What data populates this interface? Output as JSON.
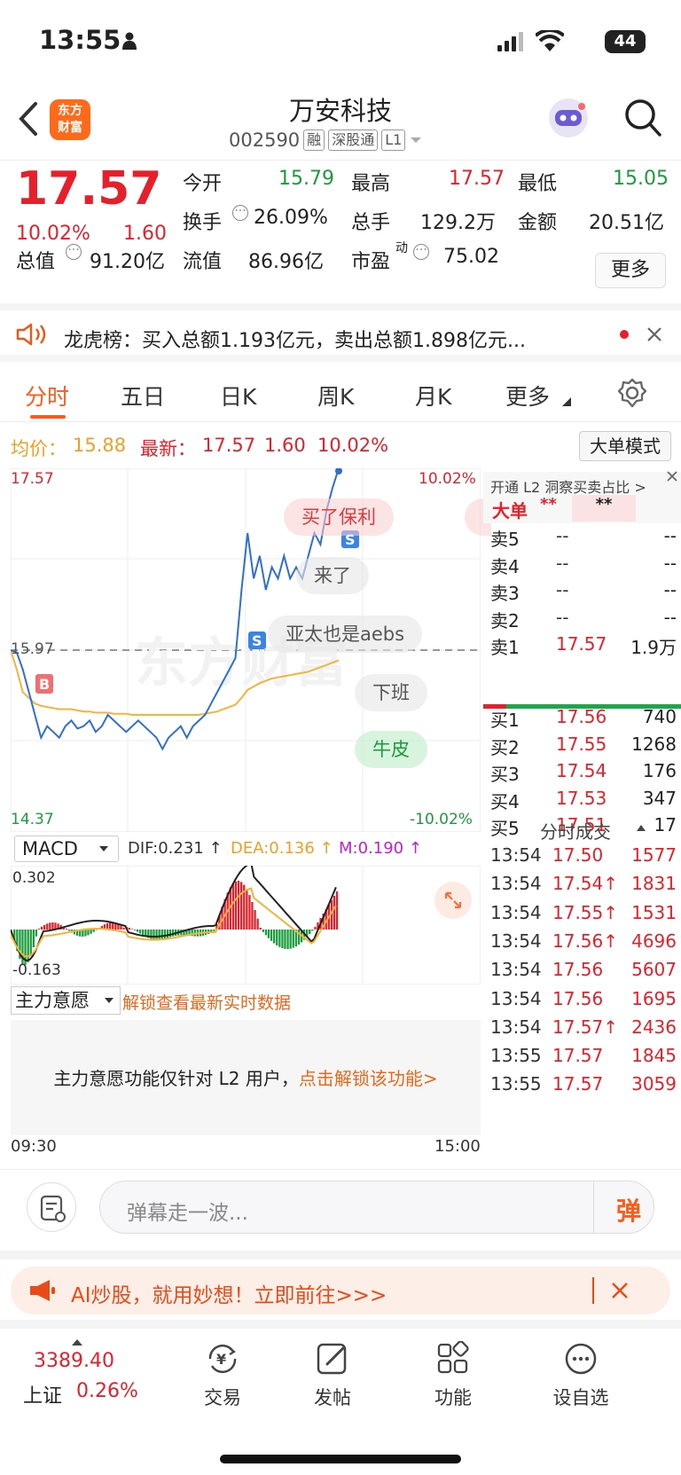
{
  "status": {
    "time": "13:55",
    "battery": "44"
  },
  "header": {
    "name": "万安科技",
    "code": "002590",
    "tags": [
      "融",
      "深股通",
      "L1"
    ],
    "logo_line1": "东方",
    "logo_line2": "财富"
  },
  "quote": {
    "price": "17.57",
    "change_pct": "10.02%",
    "change": "1.60",
    "open_label": "今开",
    "open": "15.79",
    "high_label": "最高",
    "high": "17.57",
    "low_label": "最低",
    "low": "15.05",
    "turnover_label": "换手",
    "turnover": "26.09%",
    "volume_label": "总手",
    "volume": "129.2万",
    "amount_label": "金额",
    "amount": "20.51亿",
    "mktcap_label": "总值",
    "mktcap": "91.20亿",
    "float_label": "流值",
    "float": "86.96亿",
    "pe_label": "市盈",
    "pe_sup": "动",
    "pe": "75.02",
    "more": "更多"
  },
  "notice": {
    "text": "龙虎榜：买入总额1.193亿元，卖出总额1.898亿元..."
  },
  "tabs": [
    "分时",
    "五日",
    "日K",
    "周K",
    "月K",
    "更多"
  ],
  "avg": {
    "avg_label": "均价：",
    "avg": "15.88",
    "latest_label": "最新：",
    "latest": "17.57",
    "chg": "1.60",
    "pct": "10.02%",
    "big_order_mode": "大单模式"
  },
  "chart_data": {
    "type": "line",
    "title": "",
    "y_top": "17.57",
    "y_bottom": "14.37",
    "pct_top": "10.02%",
    "pct_bottom": "-10.02%",
    "prev_close_label": "15.97",
    "ylim": [
      14.37,
      17.57
    ],
    "x_start": "09:30",
    "x_end": "15:00",
    "series": [
      {
        "name": "价格",
        "values": [
          15.97,
          15.95,
          15.8,
          15.6,
          15.4,
          15.2,
          15.3,
          15.25,
          15.2,
          15.3,
          15.35,
          15.28,
          15.3,
          15.35,
          15.25,
          15.3,
          15.4,
          15.35,
          15.3,
          15.25,
          15.3,
          15.35,
          15.3,
          15.25,
          15.2,
          15.1,
          15.2,
          15.25,
          15.3,
          15.2,
          15.3,
          15.35,
          15.4,
          15.5,
          15.6,
          15.7,
          15.8,
          15.9,
          16.5,
          17.0,
          16.6,
          16.8,
          16.5,
          16.7,
          16.6,
          16.8,
          16.6,
          16.7,
          16.6,
          16.8,
          17.0,
          16.9,
          17.2,
          17.4,
          17.57
        ]
      },
      {
        "name": "均价",
        "values": [
          15.97,
          15.8,
          15.6,
          15.55,
          15.5,
          15.48,
          15.47,
          15.46,
          15.45,
          15.45,
          15.45,
          15.44,
          15.43,
          15.43,
          15.42,
          15.42,
          15.42,
          15.41,
          15.41,
          15.41,
          15.4,
          15.4,
          15.4,
          15.4,
          15.4,
          15.4,
          15.4,
          15.4,
          15.4,
          15.4,
          15.4,
          15.4,
          15.41,
          15.42,
          15.43,
          15.45,
          15.47,
          15.49,
          15.55,
          15.62,
          15.65,
          15.68,
          15.7,
          15.72,
          15.73,
          15.74,
          15.75,
          15.76,
          15.77,
          15.78,
          15.8,
          15.82,
          15.84,
          15.86,
          15.88
        ]
      }
    ]
  },
  "danmu": [
    "买了保利",
    "来了",
    "亚太也是aebs",
    "下班",
    "牛皮"
  ],
  "orderbook": {
    "l2_banner": "开通 L2 洞察买卖占比 >",
    "big_order_label": "大单",
    "big_order_value": "**",
    "big_order_value2": "**",
    "asks": [
      {
        "label": "卖5",
        "price": "--",
        "vol": "--"
      },
      {
        "label": "卖4",
        "price": "--",
        "vol": "--"
      },
      {
        "label": "卖3",
        "price": "--",
        "vol": "--"
      },
      {
        "label": "卖2",
        "price": "--",
        "vol": "--"
      },
      {
        "label": "卖1",
        "price": "17.57",
        "vol": "1.9万"
      }
    ],
    "bids": [
      {
        "label": "买1",
        "price": "17.56",
        "vol": "740"
      },
      {
        "label": "买2",
        "price": "17.55",
        "vol": "1268"
      },
      {
        "label": "买3",
        "price": "17.54",
        "vol": "176"
      },
      {
        "label": "买4",
        "price": "17.53",
        "vol": "347"
      },
      {
        "label": "买5",
        "price": "17.51",
        "vol": "17"
      }
    ],
    "ticks_title": "分时成交",
    "ticks": [
      {
        "time": "13:54",
        "price": "17.50",
        "vol": "1577"
      },
      {
        "time": "13:54",
        "price": "17.54↑",
        "vol": "1831"
      },
      {
        "time": "13:54",
        "price": "17.55↑",
        "vol": "1531"
      },
      {
        "time": "13:54",
        "price": "17.56↑",
        "vol": "4696"
      },
      {
        "time": "13:54",
        "price": "17.56",
        "vol": "5607"
      },
      {
        "time": "13:54",
        "price": "17.56",
        "vol": "1695"
      },
      {
        "time": "13:54",
        "price": "17.57↑",
        "vol": "2436"
      },
      {
        "time": "13:55",
        "price": "17.57",
        "vol": "1845"
      },
      {
        "time": "13:55",
        "price": "17.57",
        "vol": "3059"
      }
    ]
  },
  "macd": {
    "select": "MACD",
    "dif": "DIF:0.231 ↑",
    "dea": "DEA:0.136 ↑",
    "m": "M:0.190 ↑",
    "top": "0.302",
    "bottom": "-0.163"
  },
  "main_will": {
    "select": "主力意愿",
    "unlock_link": "解锁查看最新实时数据",
    "lock_text": "主力意愿功能仅针对 L2 用户，",
    "lock_link": "点击解锁该功能>"
  },
  "comment": {
    "placeholder": "弹幕走一波...",
    "danmu_btn": "弹"
  },
  "ai_banner": {
    "text": "AI炒股，就用妙想！立即前往>>>"
  },
  "bottomnav": {
    "index_value": "3389.40",
    "index_name": "上证",
    "index_pct": "0.26%",
    "items": [
      "交易",
      "发帖",
      "功能",
      "设自选"
    ]
  },
  "colors": {
    "up": "#e5202a",
    "down": "#1a9c3c",
    "accent": "#ff5a1a",
    "price_line": "#2f6fd0",
    "avg_line": "#f5b33a"
  }
}
